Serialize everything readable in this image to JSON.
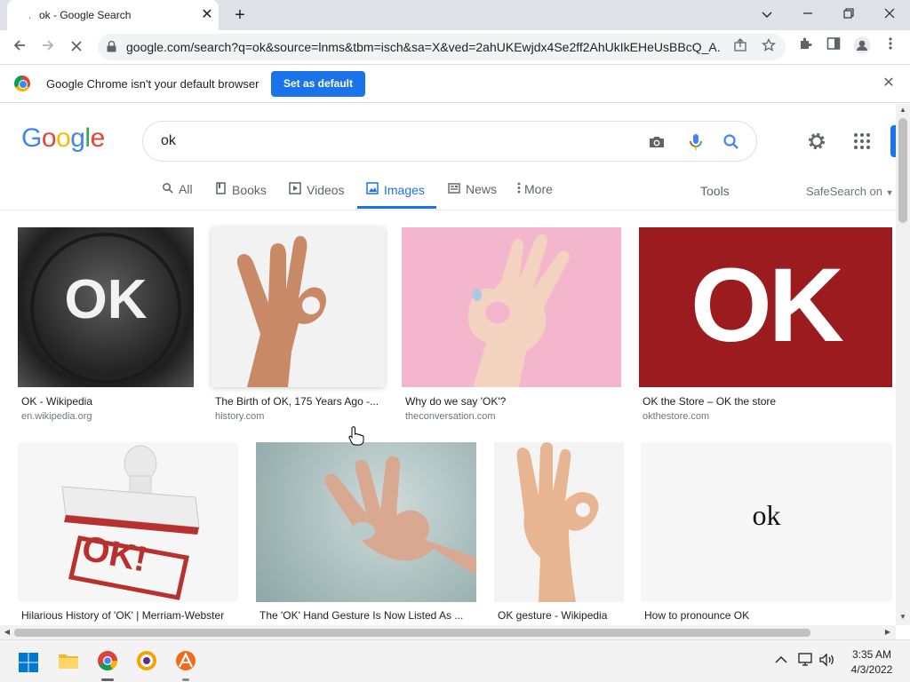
{
  "browser": {
    "tab_title": "ok - Google Search",
    "tab_loading_glyph": ".",
    "url": "google.com/search?q=ok&source=lnms&tbm=isch&sa=X&ved=2ahUKEwjdx4Se2ff2AhUkIkEHeUsBBcQ_A..."
  },
  "infobar": {
    "message": "Google Chrome isn't your default browser",
    "button": "Set as default"
  },
  "google": {
    "logo": [
      "G",
      "o",
      "o",
      "g",
      "l",
      "e"
    ],
    "logo_colors": [
      "#4285f4",
      "#ea4335",
      "#fbbc05",
      "#4285f4",
      "#34a853",
      "#ea4335"
    ],
    "query": "ok",
    "tabs": [
      {
        "label": "All",
        "icon": "search-icon"
      },
      {
        "label": "Books",
        "icon": "book-icon"
      },
      {
        "label": "Videos",
        "icon": "play-icon"
      },
      {
        "label": "Images",
        "icon": "image-icon"
      },
      {
        "label": "News",
        "icon": "news-icon"
      },
      {
        "label": "More",
        "icon": "more-vert-icon"
      }
    ],
    "tools": "Tools",
    "safesearch": "SafeSearch on"
  },
  "results": [
    {
      "title": "OK - Wikipedia",
      "source": "en.wikipedia.org",
      "thumb_text": "OK"
    },
    {
      "title": "The Birth of OK, 175 Years Ago -...",
      "source": "history.com",
      "thumb_text": ""
    },
    {
      "title": "Why do we say 'OK'?",
      "source": "theconversation.com",
      "thumb_text": ""
    },
    {
      "title": "OK the Store – OK the store",
      "source": "okthestore.com",
      "thumb_text": "OK"
    },
    {
      "title": "Hilarious History of 'OK' | Merriam-Webster",
      "source": "",
      "thumb_text": "OK!"
    },
    {
      "title": "The 'OK' Hand Gesture Is Now Listed As ...",
      "source": "",
      "thumb_text": ""
    },
    {
      "title": "OK gesture - Wikipedia",
      "source": "",
      "thumb_text": ""
    },
    {
      "title": "How to pronounce OK",
      "source": "",
      "thumb_text": "ok"
    }
  ],
  "taskbar": {
    "time": "3:35 AM",
    "date": "4/3/2022"
  }
}
